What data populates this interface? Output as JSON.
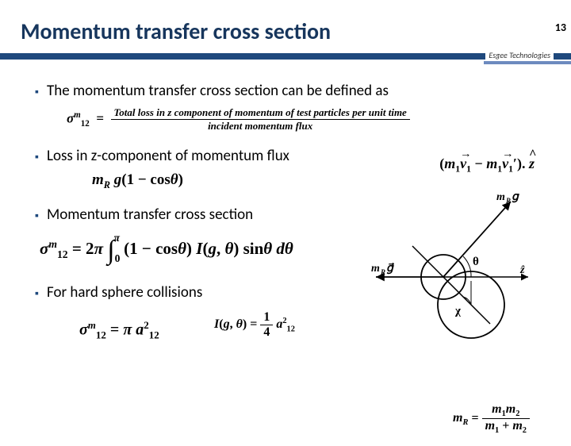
{
  "page_number": "13",
  "title": "Momentum transfer cross section",
  "brand": "Esgee Technologies",
  "bullets": {
    "b1": "The momentum transfer cross section can be defined as",
    "b2": "Loss in z-component of momentum flux",
    "b3": "Momentum transfer cross section",
    "b4": "For hard sphere collisions"
  },
  "eq": {
    "sigma_def_sym": "σ",
    "sigma_def_sub": "12",
    "sigma_def_sup": "m",
    "def_num": "Total loss in z component of momentum of test particles per unit time",
    "def_den": "incident momentum flux",
    "loss_rhs": "(m₁v⃗₁ − m₁v⃗₁′). ẑ",
    "loss_formula": "mR g(1 − cosθ)",
    "integral": "σ₁₂ᵐ = 2π ∫₀π (1 − cosθ) I(g, θ) sinθ dθ",
    "hard_I": "I(g, θ) =",
    "hard_I_num": "1",
    "hard_I_den": "4",
    "hard_I_a": "a₁₂²",
    "hard_sigma": "σ₁₂ᵐ = π a₁₂²",
    "mRg_label": "mR g⃗",
    "zhat_label": "ẑ",
    "theta": "θ",
    "chi": "χ",
    "reduced_lhs": "mR =",
    "reduced_num": "m₁m₂",
    "reduced_den": "m₁ + m₂"
  }
}
